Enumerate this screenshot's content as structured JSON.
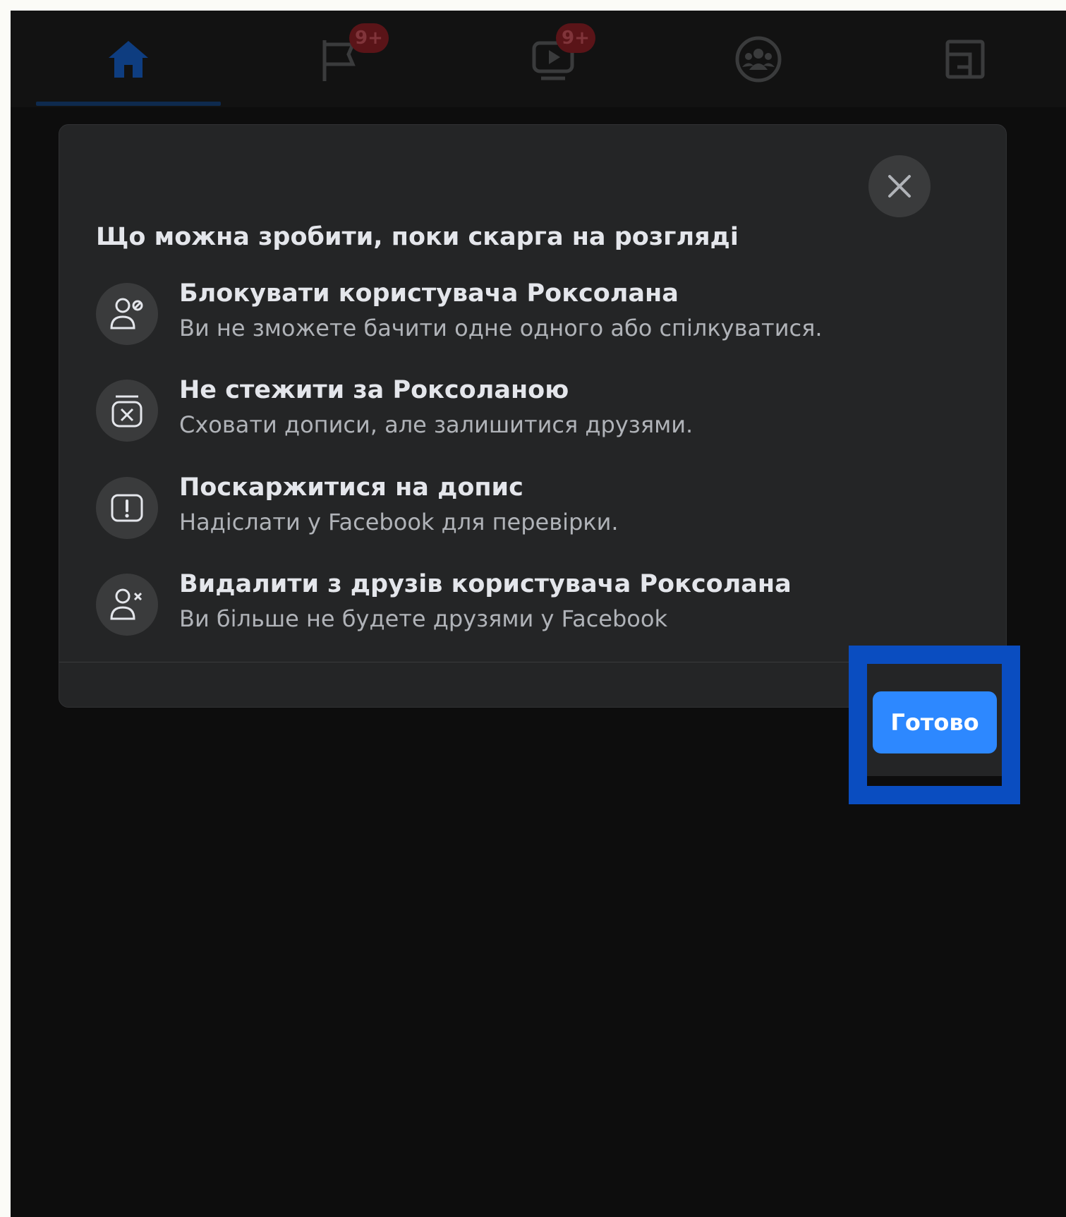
{
  "nav": {
    "tabs": [
      {
        "icon": "home-icon",
        "active": true
      },
      {
        "icon": "flag-icon",
        "badge": "9+"
      },
      {
        "icon": "video-icon",
        "badge": "9+"
      },
      {
        "icon": "groups-icon"
      },
      {
        "icon": "gaming-icon"
      }
    ]
  },
  "modal": {
    "title": "Що можна зробити, поки скарга на розгляді",
    "options": [
      {
        "icon": "block-user-icon",
        "title": "Блокувати користувача Роксолана",
        "description": "Ви не зможете бачити одне одного або спілкуватися."
      },
      {
        "icon": "unfollow-icon",
        "title": "Не стежити за Роксоланою",
        "description": "Сховати дописи, але залишитися друзями."
      },
      {
        "icon": "report-icon",
        "title": "Поскаржитися на допис",
        "description": "Надіслати у Facebook для перевірки."
      },
      {
        "icon": "unfriend-icon",
        "title": "Видалити з друзів користувача Роксолана",
        "description": "Ви більше не будете друзями у Facebook"
      }
    ],
    "done_label": "Готово"
  },
  "colors": {
    "accent": "#2d88ff",
    "highlight": "#0a4dc0",
    "modal_bg": "#242526",
    "page_bg": "#0d0d0d"
  }
}
